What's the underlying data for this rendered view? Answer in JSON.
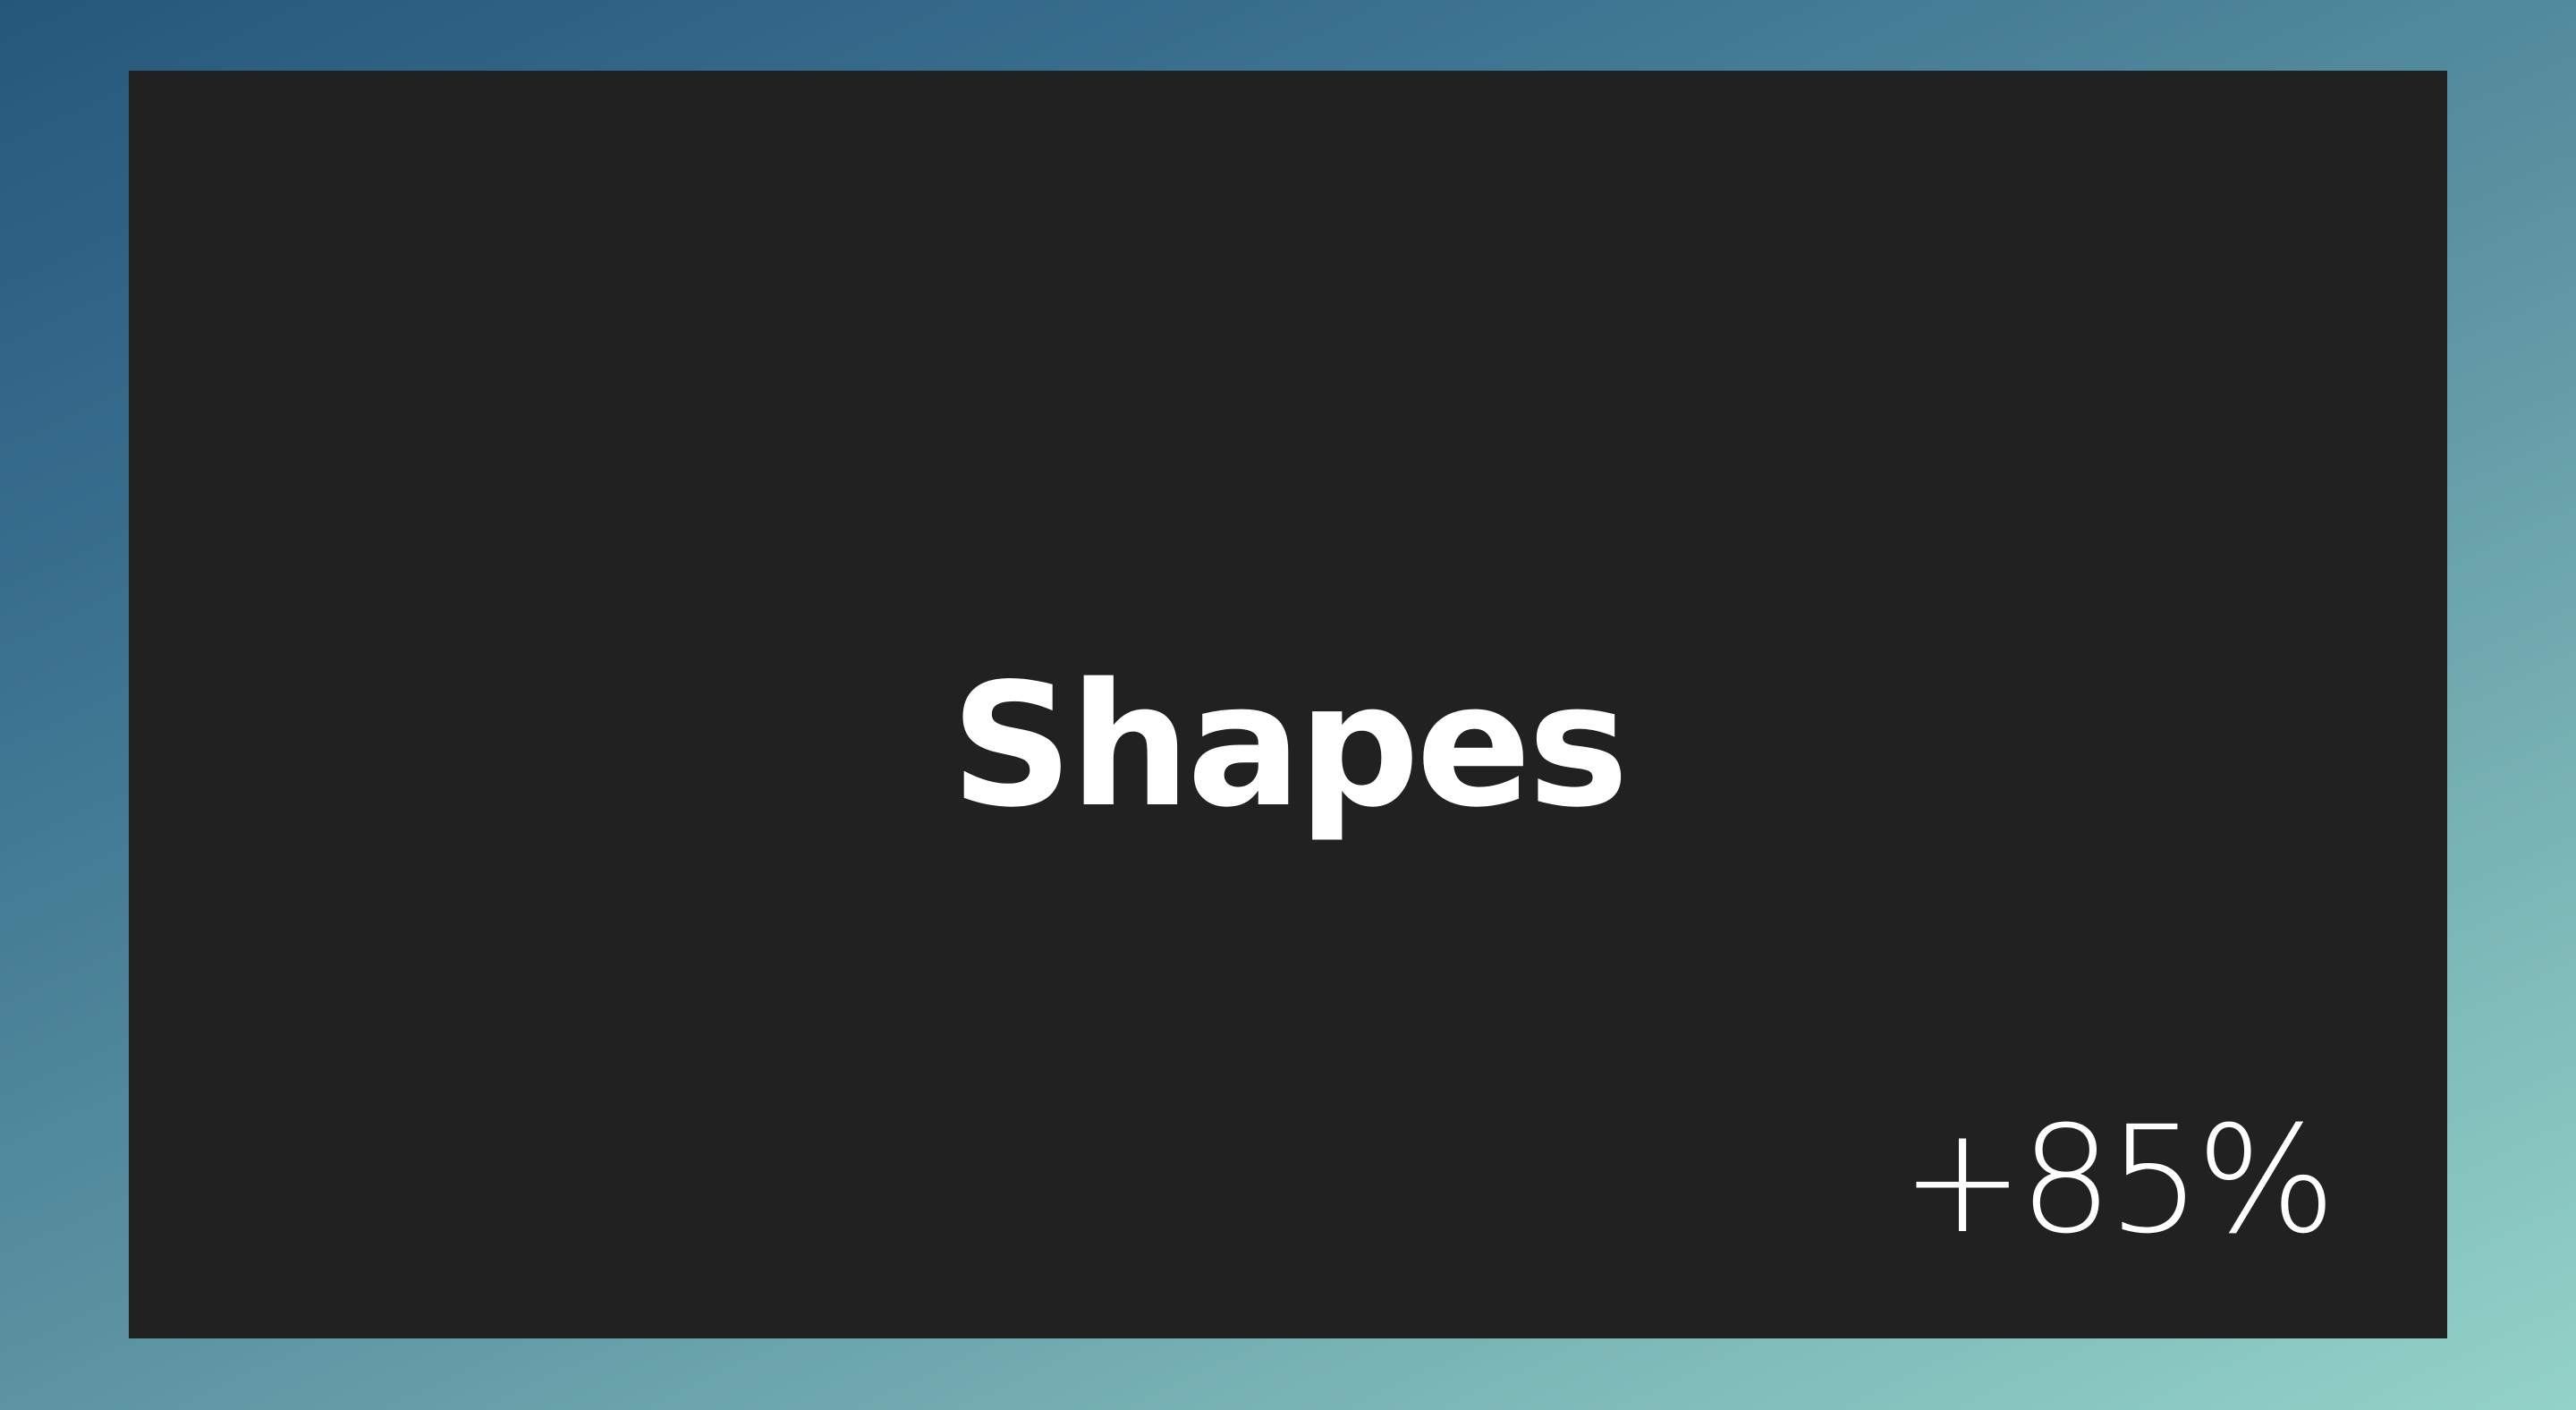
{
  "slide": {
    "title": "Shapes",
    "stat": "+85%"
  },
  "colors": {
    "panel": "#212121",
    "text": "#ffffff",
    "gradient_start": "#25577b",
    "gradient_end": "#93d2c8"
  }
}
